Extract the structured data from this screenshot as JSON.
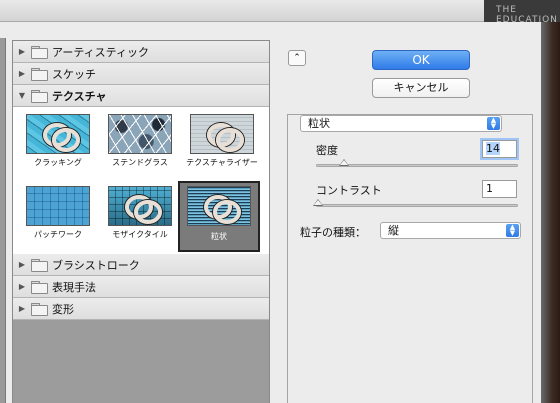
{
  "background": {
    "strip_text": "THE EDUCATION"
  },
  "gallery": {
    "categories_top": [
      {
        "label": "アーティスティック",
        "open": false
      },
      {
        "label": "スケッチ",
        "open": false
      },
      {
        "label": "テクスチャ",
        "open": true
      }
    ],
    "thumbnails": [
      {
        "label": "クラッキング",
        "icon": "craquelure-thumbnail-icon",
        "selected": false
      },
      {
        "label": "ステンドグラス",
        "icon": "stained-glass-thumbnail-icon",
        "selected": false
      },
      {
        "label": "テクスチャライザー",
        "icon": "texturizer-thumbnail-icon",
        "selected": false
      },
      {
        "label": "パッチワーク",
        "icon": "patchwork-thumbnail-icon",
        "selected": false
      },
      {
        "label": "モザイクタイル",
        "icon": "mosaic-tiles-thumbnail-icon",
        "selected": false
      },
      {
        "label": "粒状",
        "icon": "grain-thumbnail-icon",
        "selected": true
      }
    ],
    "categories_bottom": [
      {
        "label": "ブラシストローク",
        "open": false
      },
      {
        "label": "表現手法",
        "open": false
      },
      {
        "label": "変形",
        "open": false
      }
    ]
  },
  "buttons": {
    "collapse_glyph": "⌃",
    "ok_label": "OK",
    "cancel_label": "キャンセル"
  },
  "settings": {
    "filter_select": "粒状",
    "params": [
      {
        "label": "密度",
        "value": "14",
        "slider_fraction": 0.14
      },
      {
        "label": "コントラスト",
        "value": "1",
        "slider_fraction": 0.01
      }
    ],
    "grain_type_label": "粒子の種類：",
    "grain_type_value": "縦"
  },
  "colors": {
    "ok_button": "#2f7ae8",
    "select_arrow": "#2f7ae8"
  }
}
